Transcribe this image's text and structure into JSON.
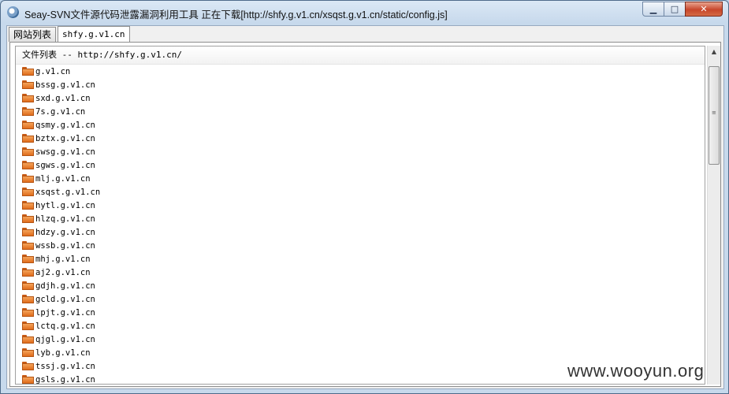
{
  "window": {
    "title": "Seay-SVN文件源代码泄露漏洞利用工具  正在下载[http://shfy.g.v1.cn/xsqst.g.v1.cn/static/config.js]",
    "min_glyph": "▁",
    "max_glyph": "□",
    "close_glyph": "✕"
  },
  "tabs": [
    {
      "label": "网站列表"
    },
    {
      "label": "shfy.g.v1.cn"
    }
  ],
  "file_list": {
    "header": "文件列表 -- http://shfy.g.v1.cn/",
    "items": [
      "g.v1.cn",
      "bssg.g.v1.cn",
      "sxd.g.v1.cn",
      "7s.g.v1.cn",
      "qsmy.g.v1.cn",
      "bztx.g.v1.cn",
      "swsg.g.v1.cn",
      "sgws.g.v1.cn",
      "mlj.g.v1.cn",
      "xsqst.g.v1.cn",
      "hytl.g.v1.cn",
      "hlzq.g.v1.cn",
      "hdzy.g.v1.cn",
      "wssb.g.v1.cn",
      "mhj.g.v1.cn",
      "aj2.g.v1.cn",
      "gdjh.g.v1.cn",
      "gcld.g.v1.cn",
      "lpjt.g.v1.cn",
      "lctq.g.v1.cn",
      "qjgl.g.v1.cn",
      "lyb.g.v1.cn",
      "tssj.g.v1.cn",
      "gsls.g.v1.cn"
    ]
  },
  "scrollbar": {
    "up_glyph": "▲",
    "grip_glyph": "≡"
  },
  "watermark": "www.wooyun.org"
}
